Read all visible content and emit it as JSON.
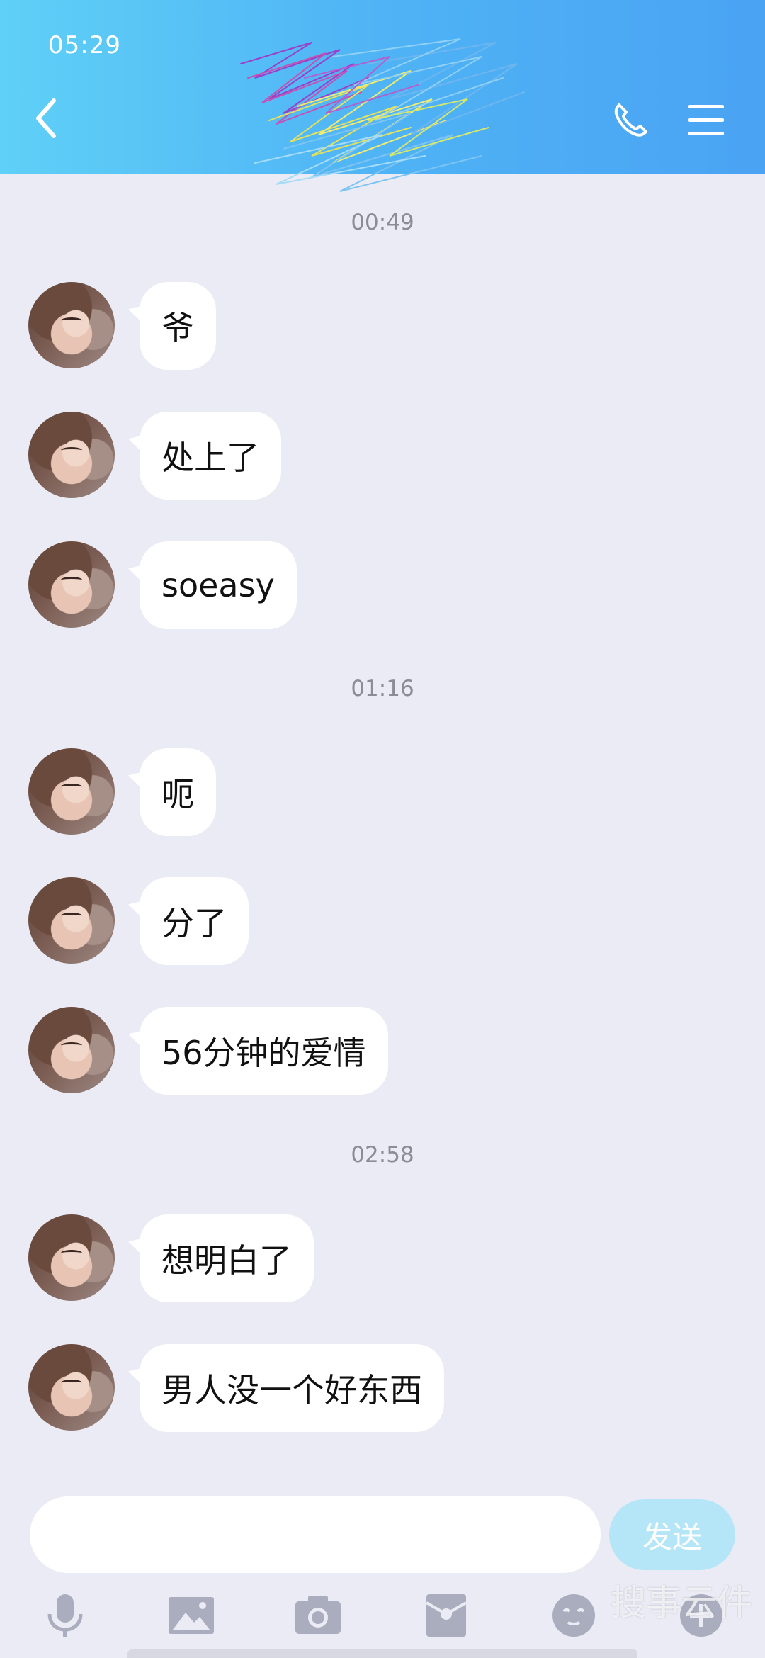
{
  "status_bar": {
    "time": "05:29"
  },
  "header": {
    "title_redacted": true
  },
  "messages_groups": [
    {
      "timestamp": "00:49",
      "messages": [
        "爷",
        "处上了",
        "soeasy"
      ]
    },
    {
      "timestamp": "01:16",
      "messages": [
        "呃",
        "分了",
        "56分钟的爱情"
      ]
    },
    {
      "timestamp": "02:58",
      "messages": [
        "想明白了",
        "男人没一个好东西"
      ]
    }
  ],
  "input": {
    "value": "",
    "send_label": "发送"
  },
  "toolbar": {
    "icons": [
      "microphone-icon",
      "image-icon",
      "camera-icon",
      "red-packet-icon",
      "emoji-icon",
      "plus-icon"
    ]
  },
  "watermark": "搜事云件",
  "colors": {
    "header_gradient_start": "#5fd0f7",
    "header_gradient_end": "#4aa3f3",
    "background": "#ebebf5",
    "bubble": "#ffffff",
    "send_button": "#b4e6f8"
  }
}
